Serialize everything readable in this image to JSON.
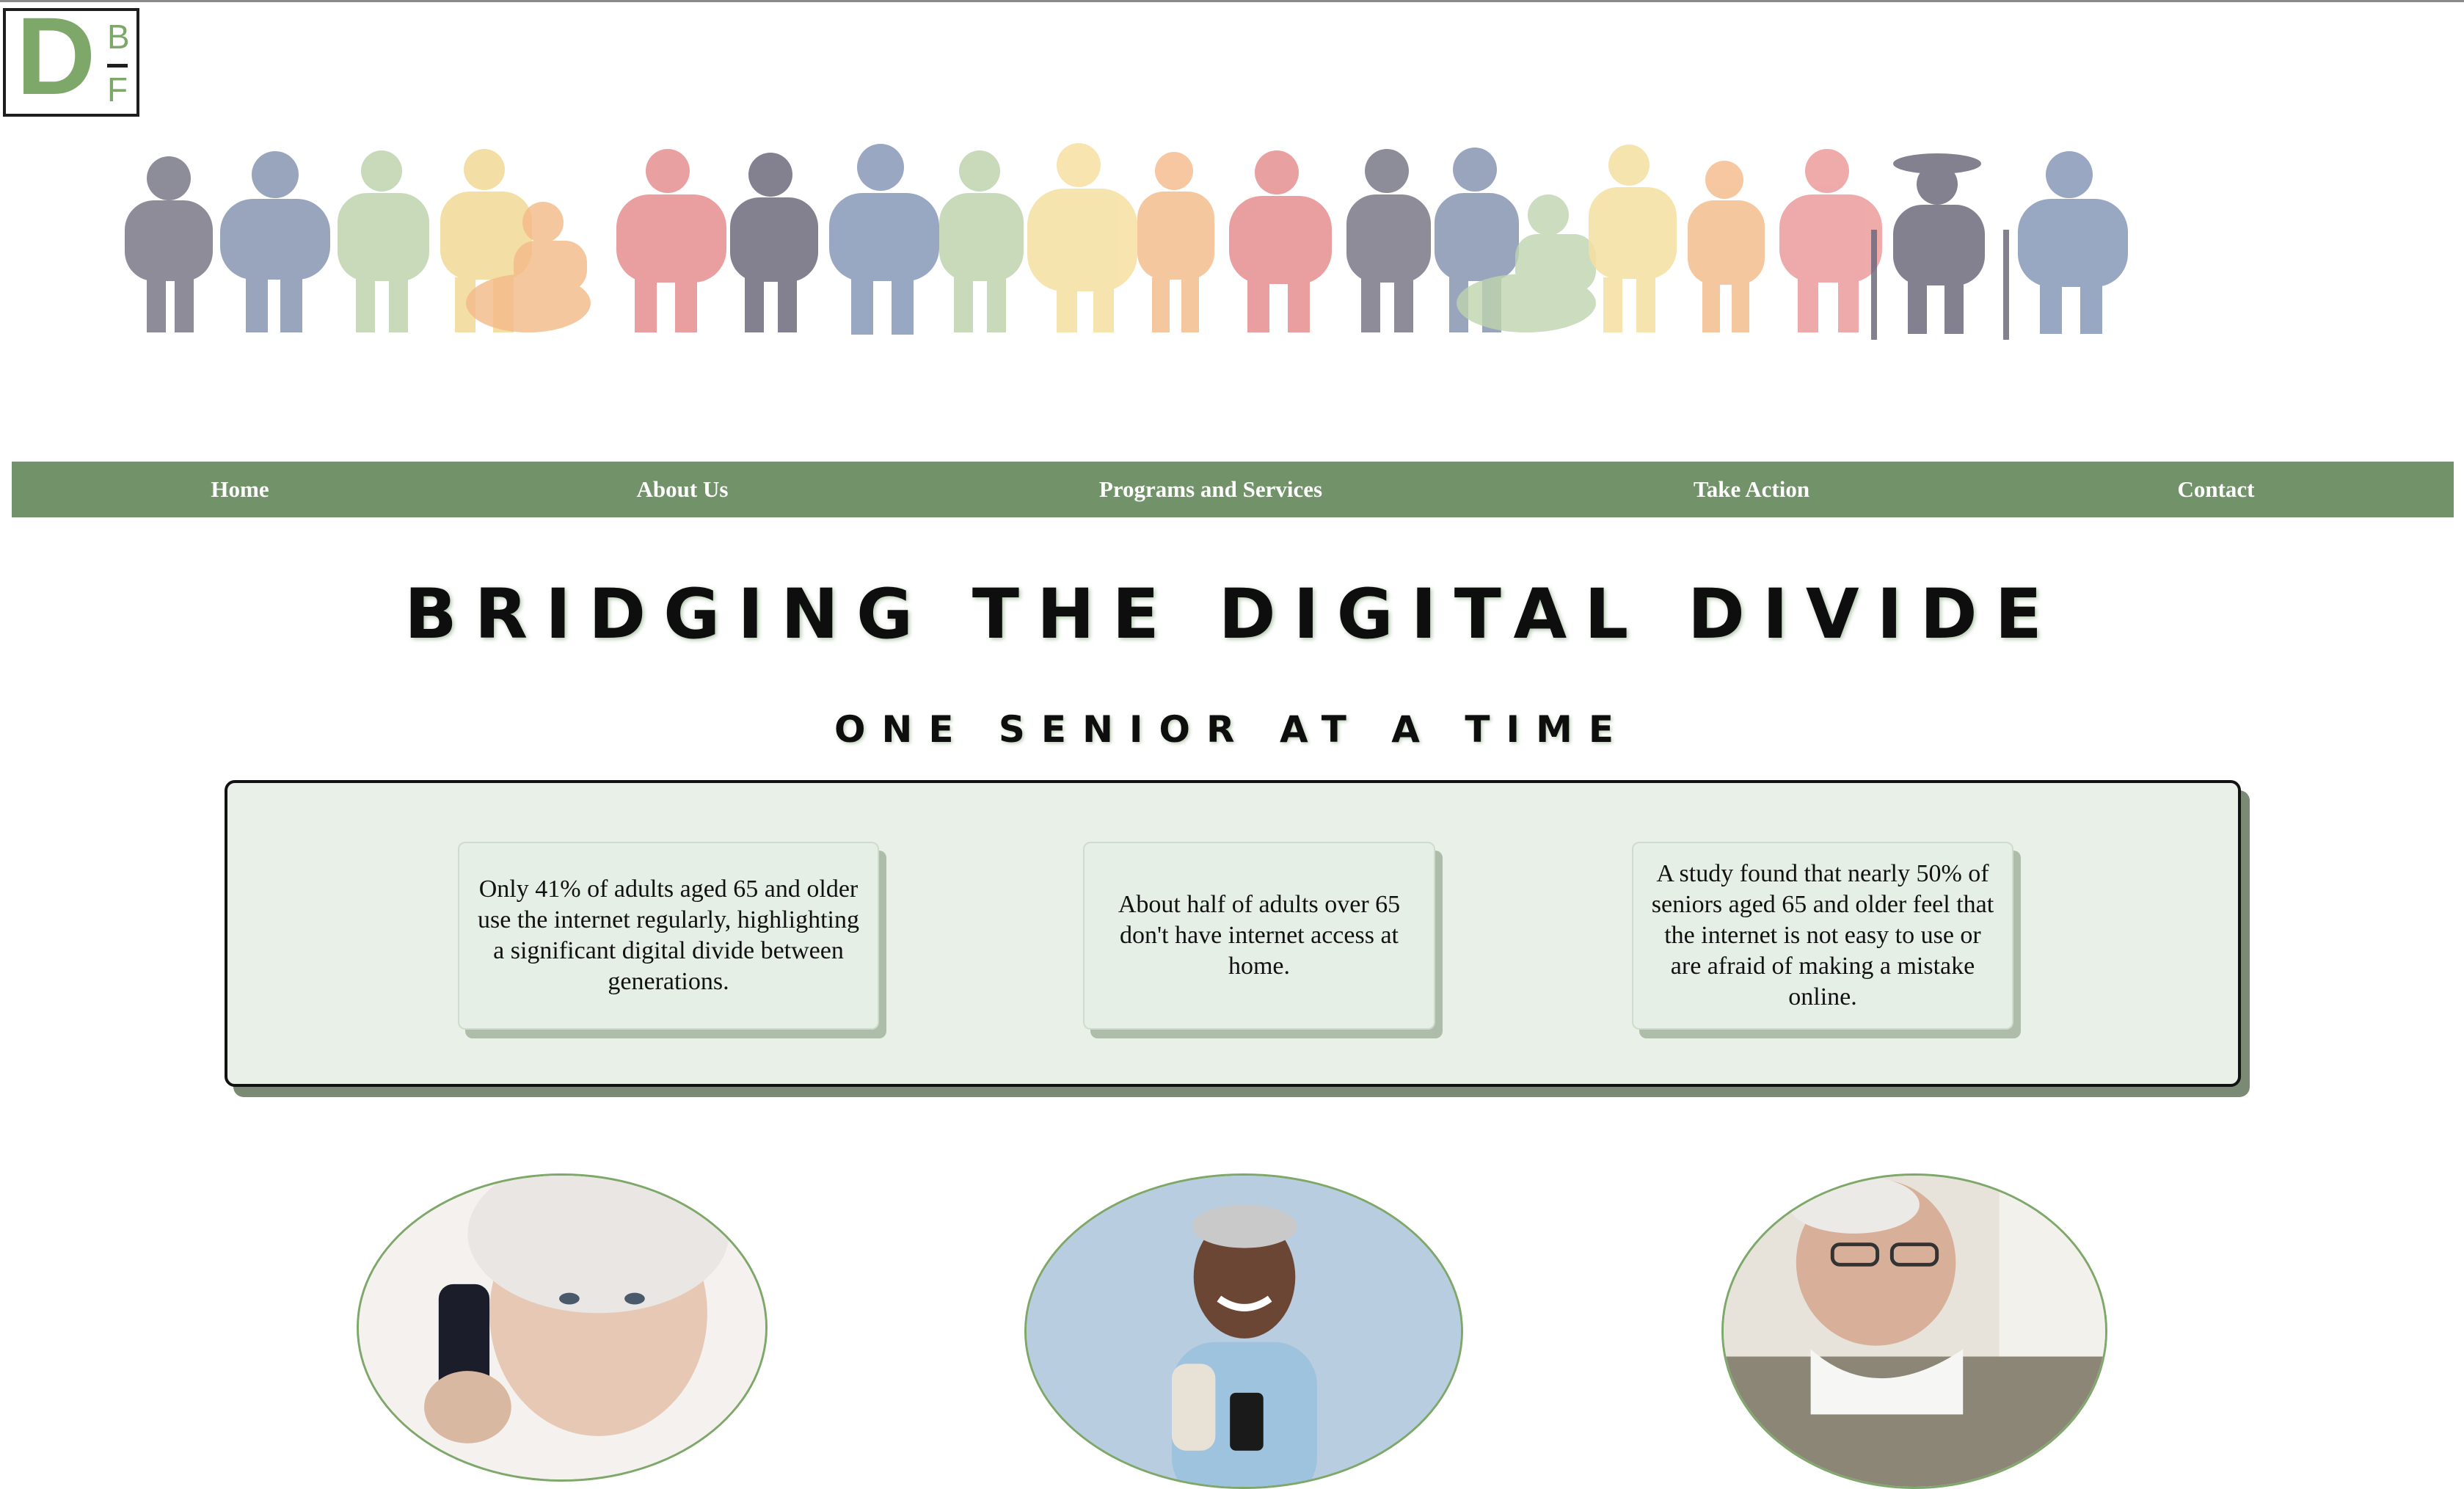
{
  "logo": {
    "letter_main": "D",
    "letter_top": "B",
    "letter_bottom": "F"
  },
  "nav": {
    "items": [
      {
        "label": "Home"
      },
      {
        "label": "About Us"
      },
      {
        "label": "Programs and Services"
      },
      {
        "label": "Take Action"
      },
      {
        "label": "Contact"
      }
    ]
  },
  "hero": {
    "headline": "BRIDGING THE DIGITAL DIVIDE",
    "subheadline": "ONE SENIOR AT A TIME"
  },
  "stats": [
    {
      "text": "Only 41% of adults aged 65 and older use the internet regularly, highlighting a significant digital divide between generations."
    },
    {
      "text": "About half of adults over 65 don't have internet access at home."
    },
    {
      "text": "A study found that nearly 50% of seniors aged 65 and older feel that the internet is not easy to use or are afraid of making a mistake online."
    }
  ],
  "colors": {
    "brand_green": "#7ea86a",
    "nav_green": "#72926a",
    "panel_bg": "#e8f0e7",
    "panel_shadow": "#7b8a74"
  },
  "portraits": [
    {
      "icon": "senior-woman-phone-photo"
    },
    {
      "icon": "senior-man-smartphone-photo"
    },
    {
      "icon": "senior-man-glasses-reading-photo"
    }
  ]
}
